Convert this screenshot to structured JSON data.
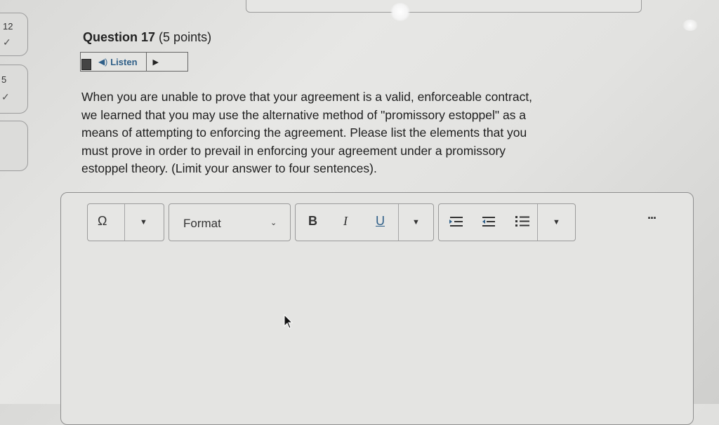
{
  "sidebar": {
    "items": [
      {
        "number": "12",
        "status": "answered"
      },
      {
        "number": "5",
        "status": "answered"
      }
    ]
  },
  "question": {
    "title": "Question 17",
    "points": "(5 points)",
    "listen_label": "Listen",
    "text_lines": [
      "When you are unable to prove that your agreement is a valid, enforceable contract,",
      "we learned that you may use the alternative method of \"promissory estoppel\" as a",
      "means of attempting to enforcing the agreement. Please list the elements that you",
      "must prove in order to prevail in enforcing your agreement under a promissory",
      "estoppel theory. (Limit your answer to four sentences)."
    ]
  },
  "editor": {
    "toolbar": {
      "special_char_icon": "Ω",
      "format_label": "Format",
      "bold_label": "B",
      "italic_label": "I",
      "underline_label": "U",
      "more_label": "..."
    },
    "content": ""
  }
}
